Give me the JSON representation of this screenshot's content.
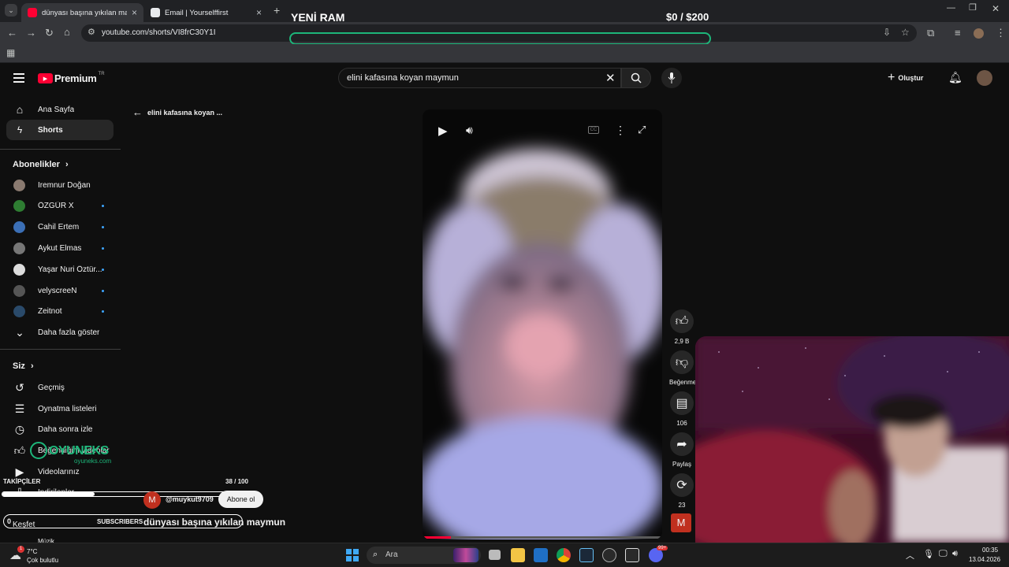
{
  "browser": {
    "tabs": [
      {
        "title": "dünyası başına yıkılan maymun",
        "active": true
      },
      {
        "title": "Email | Yourselffirst",
        "active": false
      }
    ],
    "url": "youtube.com/shorts/VI8frC30Y1I"
  },
  "overlay": {
    "ram_title": "YENİ RAM",
    "goal": "$0 / $200",
    "followers_label": "TAKİPÇİLER",
    "followers_progress": "38 / 100",
    "followers_fraction": 0.38,
    "subscribers_count": "0",
    "subscribers_label": "SUBSCRIBERS",
    "brand": "OYUNEKS",
    "brand_url": "oyuneks.com"
  },
  "youtube": {
    "logo": "Premium",
    "logo_badge": "TR",
    "search_query": "elini kafasına koyan maymun",
    "create_label": "Oluştur",
    "back_label": "elini kafasına koyan ...",
    "sidebar": {
      "home": "Ana Sayfa",
      "shorts": "Shorts",
      "subscriptions_title": "Abonelikler",
      "subscriptions": [
        {
          "name": "İremnur Doğan",
          "dot": false,
          "color": "#8a7a70"
        },
        {
          "name": "ÖZGÜR X",
          "dot": true,
          "color": "#2e7d32"
        },
        {
          "name": "Cahil Ertem",
          "dot": true,
          "color": "#3b6fb6"
        },
        {
          "name": "Aykut Elmas",
          "dot": true,
          "color": "#777777"
        },
        {
          "name": "Yaşar Nuri Öztür...",
          "dot": true,
          "color": "#dddddd"
        },
        {
          "name": "velyscreeN",
          "dot": true,
          "color": "#555555"
        },
        {
          "name": "Zeitnot",
          "dot": true,
          "color": "#2a4a6a"
        }
      ],
      "show_more": "Daha fazla göster",
      "you_title": "Siz",
      "you_items": [
        "Geçmiş",
        "Oynatma listeleri",
        "Daha sonra izle",
        "Beğendiğim videolar",
        "Videolarınız",
        "İndirilenler"
      ],
      "explore": "Keşfet",
      "music": "Müzik"
    },
    "short": {
      "title": "dünyası başına yıkılan maymun",
      "channel": "@muykut9709",
      "channel_initial": "M",
      "subscribe": "Abone ol",
      "likes": "2,9 B",
      "dislike": "Beğenme",
      "comments": "106",
      "share": "Paylaş",
      "remix": "23",
      "progress": 0.12
    }
  },
  "taskbar": {
    "weather_temp": "7°C",
    "weather_desc": "Çok bulutlu",
    "weather_badge": "1",
    "search": "Ara",
    "time": "00:35",
    "date": "13.04.2026",
    "discord_badge": "99+"
  },
  "colors": {
    "yt_red": "#ff0033",
    "accent_green": "#1db67a",
    "subscribe_bg": "#f1f1f1"
  }
}
